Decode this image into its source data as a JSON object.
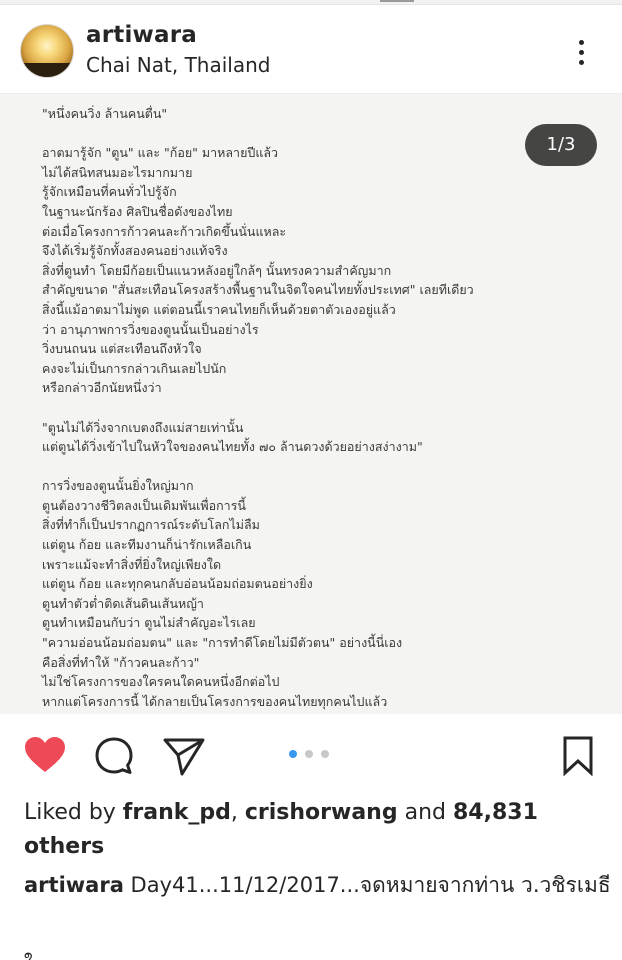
{
  "post": {
    "username": "artiwara",
    "location": "Chai Nat, Thailand",
    "slide_counter": "1/3",
    "slide_index": 1,
    "slide_total": 3
  },
  "letter": [
    "\"หนึ่งคนวิ่ง ล้านคนตื่น\"",
    "",
    "อาตมารู้จัก \"ตูน\" และ \"ก้อย\" มาหลายปีแล้ว",
    "ไม่ได้สนิทสนมอะไรมากมาย",
    "รู้จักเหมือนที่คนทั่วไปรู้จัก",
    "ในฐานะนักร้อง ศิลปินชื่อดังของไทย",
    "ต่อเมื่อโครงการก้าวคนละก้าวเกิดขึ้นนั่นแหละ",
    "จึงได้เริ่มรู้จักทั้งสองคนอย่างแท้จริง",
    "สิ่งที่ตูนทำ โดยมีก้อยเป็นแนวหลังอยู่ใกล้ๆ นั้นทรงความสำคัญมาก",
    "สำคัญขนาด \"สั่นสะเทือนโครงสร้างพื้นฐานในจิตใจคนไทยทั้งประเทศ\" เลยทีเดียว",
    "สิ่งนี้แม้อาตมาไม่พูด แต่ตอนนี้เราคนไทยก็เห็นด้วยตาตัวเองอยู่แล้ว",
    "ว่า อานุภาพการวิ่งของตูนนั้นเป็นอย่างไร",
    "วิ่งบนถนน แต่สะเทือนถึงหัวใจ",
    "คงจะไม่เป็นการกล่าวเกินเลยไปนัก",
    "หรือกล่าวอีกนัยหนึ่งว่า",
    "",
    "\"ตูนไม่ได้วิ่งจากเบตงถึงแม่สายเท่านั้น",
    "แต่ตูนได้วิ่งเข้าไปในหัวใจของคนไทยทั้ง ๗๐ ล้านดวงด้วยอย่างสง่างาม\"",
    "",
    "การวิ่งของตูนนั้นยิ่งใหญ่มาก",
    "ตูนต้องวางชีวิตลงเป็นเดิมพันเพื่อการนี้",
    "สิ่งที่ทำก็เป็นปรากฏการณ์ระดับโลกไม่ลืม",
    "แต่ตูน ก้อย และทีมงานก็น่ารักเหลือเกิน",
    "เพราะแม้จะทำสิ่งที่ยิ่งใหญ่เพียงใด",
    "แต่ตูน ก้อย และทุกคนกลับอ่อนน้อมถ่อมตนอย่างยิ่ง",
    "ตูนทำตัวต่ำติดเส้นดินเส้นหญ้า",
    "ตูนทำเหมือนกับว่า ตูนไม่สำคัญอะไรเลย",
    "\"ความอ่อนน้อมถ่อมตน\" และ \"การทำดีโดยไม่มีตัวตน\" อย่างนี้นี่เอง",
    "คือสิ่งที่ทำให้ \"ก้าวคนละก้าว\"",
    "ไม่ใช่โครงการของใครคนใดคนหนึ่งอีกต่อไป",
    "หากแต่โครงการนี้ ได้กลายเป็นโครงการของคนไทยทุกคนไปแล้ว"
  ],
  "actions": {
    "like_icon": "heart-icon",
    "comment_icon": "comment-icon",
    "share_icon": "send-icon",
    "save_icon": "bookmark-icon",
    "like_color": "#ed4956"
  },
  "likes": {
    "prefix": "Liked by ",
    "user1": "frank_pd",
    "sep": ", ",
    "user2": "crishorwang",
    "mid": " and ",
    "count": "84,831",
    "suffix": " others"
  },
  "caption": {
    "username": "artiwara",
    "text": " Day41...11/12/2017...จดหมายจากท่าน ว.วชิรเมธี"
  },
  "truncated_next": "ใ"
}
